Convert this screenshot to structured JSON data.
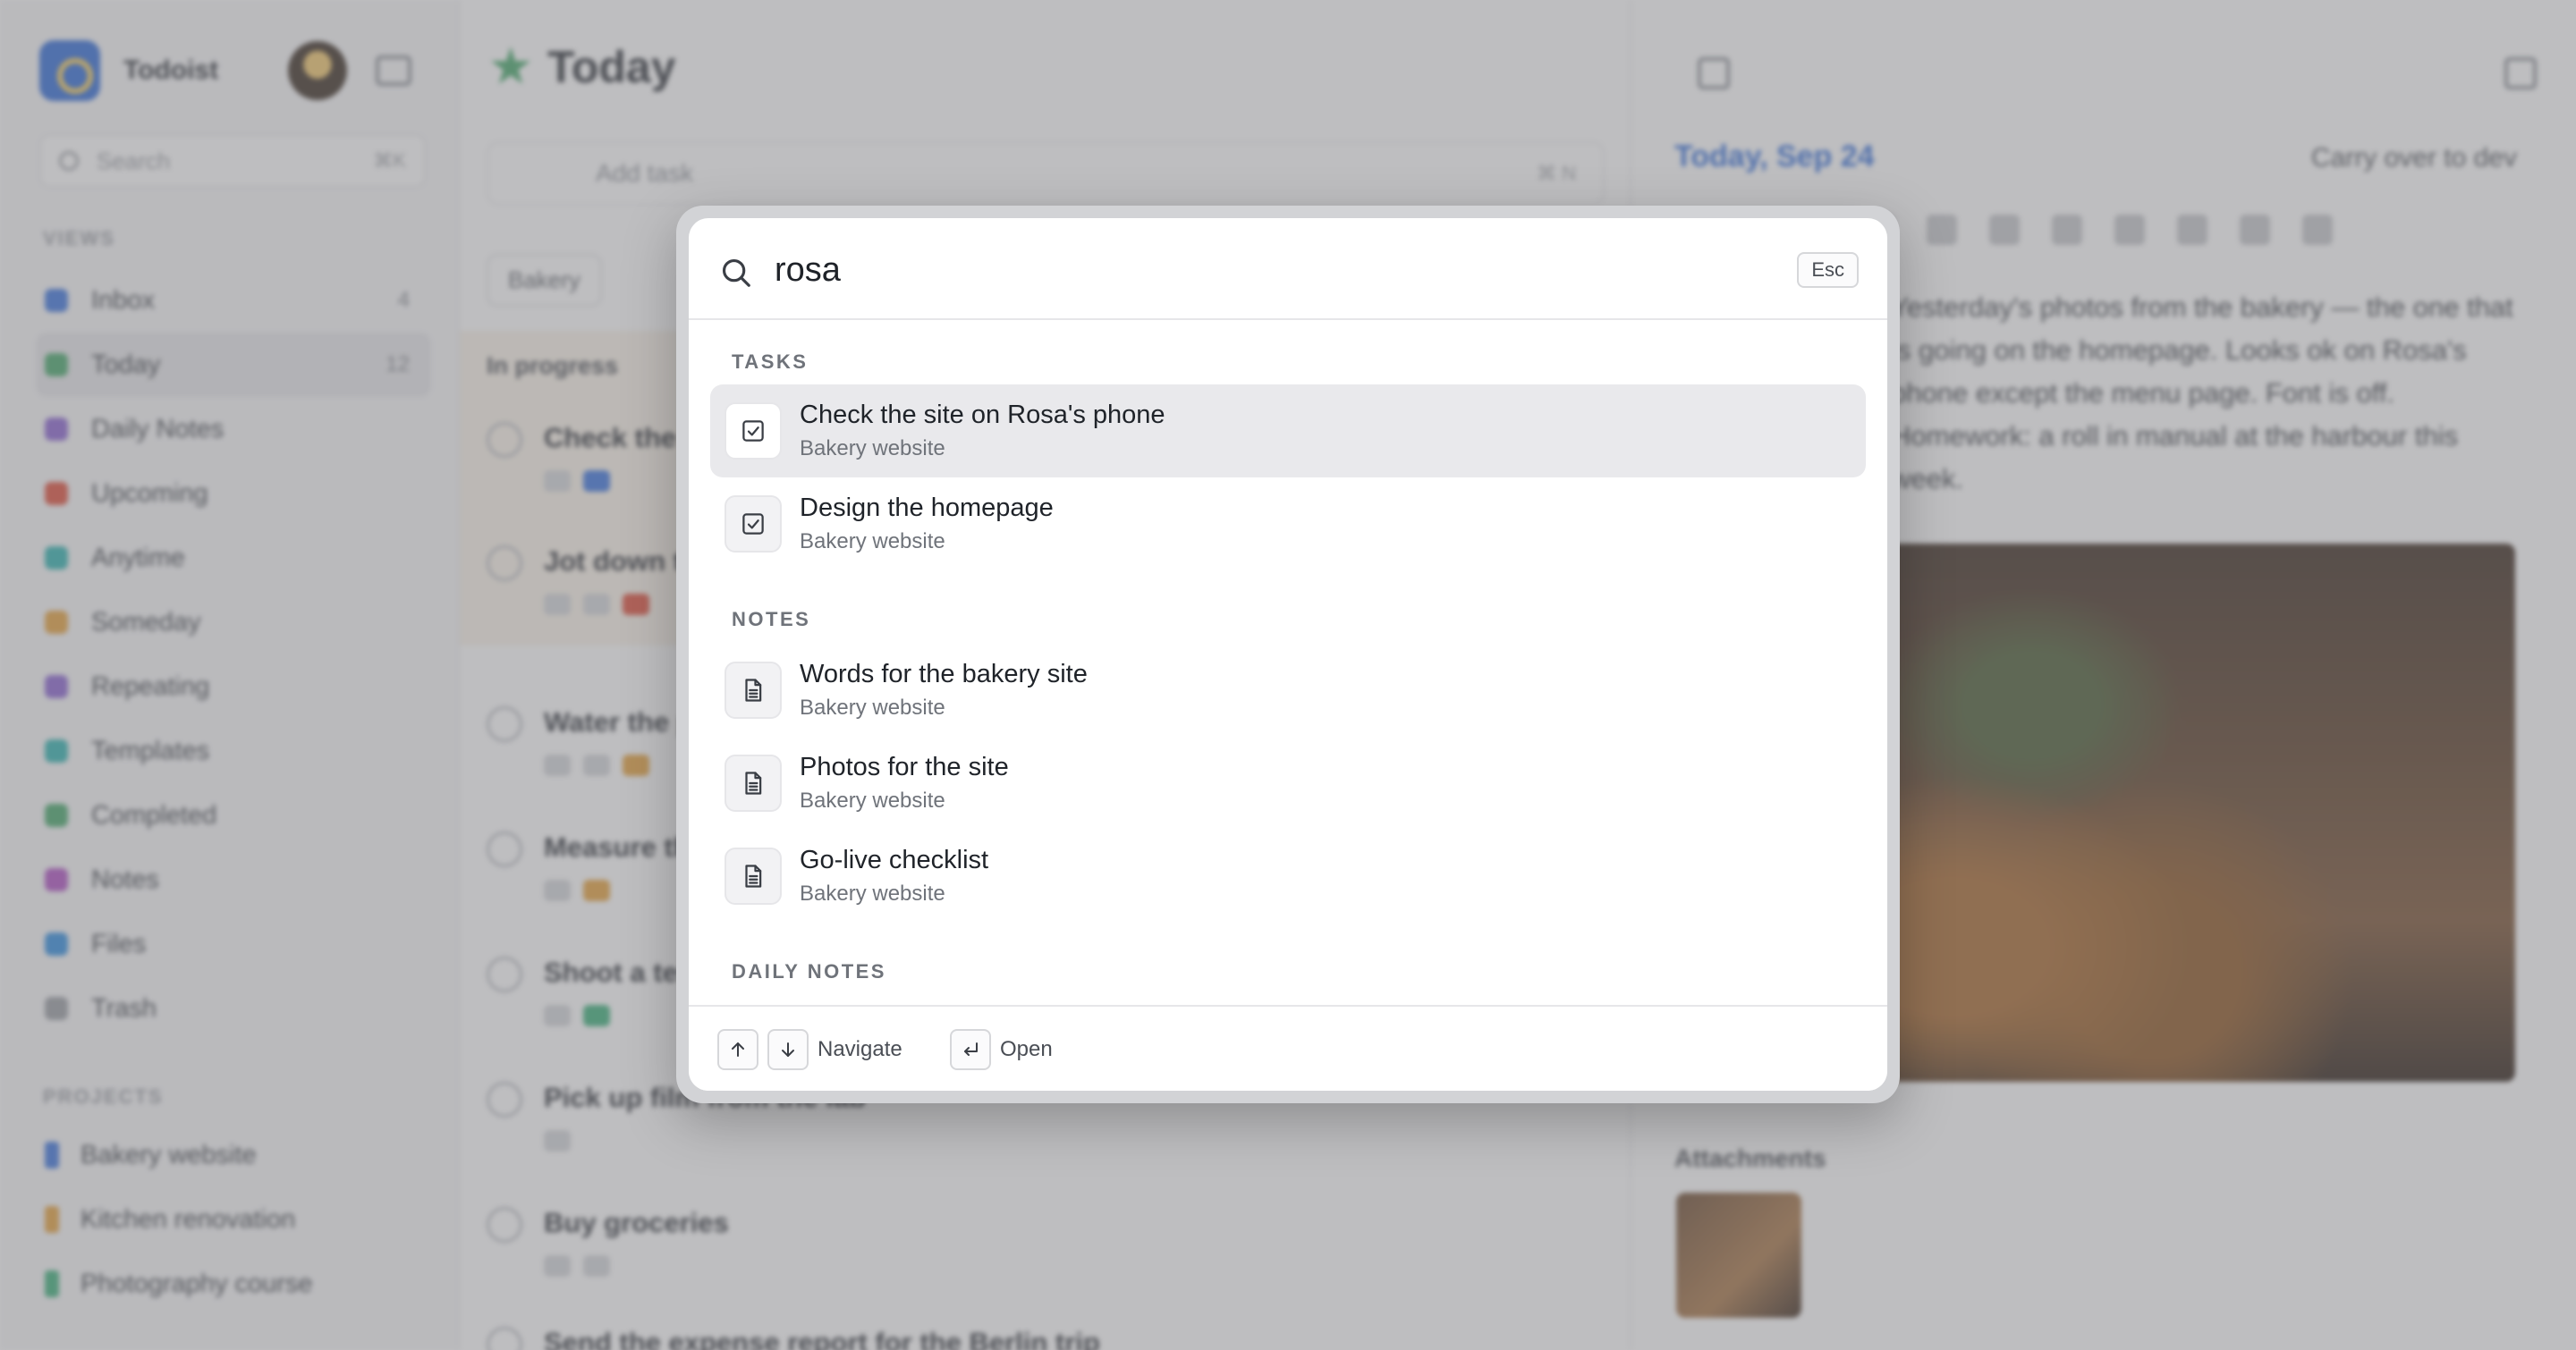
{
  "sidebar": {
    "app_name": "Todoist",
    "search_placeholder": "Search",
    "search_shortcut": "⌘K",
    "views_label": "VIEWS",
    "items": [
      {
        "label": "Inbox",
        "count": "4",
        "color": "#3b74de"
      },
      {
        "label": "Today",
        "count": "12",
        "color": "#46a86a"
      },
      {
        "label": "Daily Notes",
        "count": "",
        "color": "#8a63d2"
      },
      {
        "label": "Upcoming",
        "count": "",
        "color": "#e04e3a"
      },
      {
        "label": "Anytime",
        "count": "",
        "color": "#2eb3b0"
      },
      {
        "label": "Someday",
        "count": "",
        "color": "#e6a23c"
      },
      {
        "label": "Repeating",
        "count": "",
        "color": "#8a63d2"
      },
      {
        "label": "Templates",
        "count": "",
        "color": "#2eb3b0"
      },
      {
        "label": "Completed",
        "count": "",
        "color": "#46a86a"
      },
      {
        "label": "Notes",
        "count": "",
        "color": "#b04fc4"
      },
      {
        "label": "Files",
        "count": "",
        "color": "#2f8de0"
      },
      {
        "label": "Trash",
        "count": "",
        "color": "#9a9da3"
      }
    ],
    "projects_label": "PROJECTS",
    "projects": [
      {
        "label": "Bakery website",
        "color": "#3b74de"
      },
      {
        "label": "Kitchen renovation",
        "color": "#e6a23c"
      },
      {
        "label": "Photography course",
        "color": "#3bb07a"
      }
    ]
  },
  "main": {
    "title": "Today",
    "add_task_placeholder": "Add task",
    "add_task_shortcut": "⌘ N",
    "filter_chip": "Bakery",
    "in_progress_label": "In progress",
    "tasks": [
      {
        "title": "Check the site on Rosa's phone"
      },
      {
        "title": "Jot down the menu prices"
      },
      {
        "title": "Water the plants"
      },
      {
        "title": "Measure the kitchen window"
      },
      {
        "title": "Shoot a test roll"
      },
      {
        "title": "Pick up film from the lab"
      },
      {
        "title": "Buy groceries"
      },
      {
        "title": "Send the expense report for the Berlin trip"
      }
    ]
  },
  "detail": {
    "date": "Today, Sep 24",
    "carry_over": "Carry over to dev",
    "body": "Yesterday's photos from the bakery — the one that is going on the homepage. Looks ok on Rosa's phone except the menu page. Font is off. Homework: a roll in manual at the harbour this week.",
    "attachments_label": "Attachments"
  },
  "palette": {
    "query": "rosa",
    "esc_label": "Esc",
    "sections": {
      "tasks": "TASKS",
      "notes": "NOTES",
      "daily_notes": "DAILY NOTES"
    },
    "task_results": [
      {
        "title": "Check the site on Rosa's phone",
        "project": "Bakery website",
        "icon": "checkbox-icon"
      },
      {
        "title": "Design the homepage",
        "project": "Bakery website",
        "icon": "checkbox-icon"
      }
    ],
    "note_results": [
      {
        "title": "Words for the bakery site",
        "project": "Bakery website",
        "icon": "note-icon"
      },
      {
        "title": "Photos for the site",
        "project": "Bakery website",
        "icon": "note-icon"
      },
      {
        "title": "Go-live checklist",
        "project": "Bakery website",
        "icon": "note-icon"
      }
    ],
    "footer": {
      "navigate_label": "Navigate",
      "open_label": "Open"
    }
  }
}
